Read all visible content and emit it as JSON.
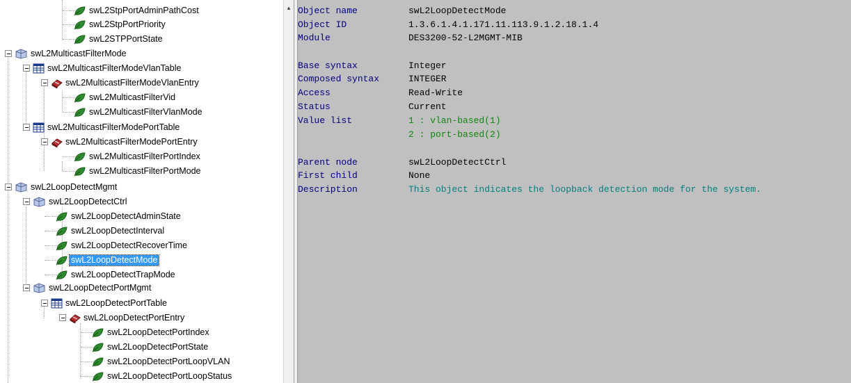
{
  "tree": {
    "items": [
      {
        "label": "swL2StpPortAdminPathCost",
        "icon": "leaf-icon"
      },
      {
        "label": "swL2StpPortPriority",
        "icon": "leaf-icon"
      },
      {
        "label": "swL2STPPortState",
        "icon": "leaf-icon"
      },
      {
        "label": "swL2MulticastFilterMode",
        "icon": "folder-icon"
      },
      {
        "label": "swL2MulticastFilterModeVlanTable",
        "icon": "table-icon"
      },
      {
        "label": "swL2MulticastFilterModeVlanEntry",
        "icon": "entry-icon"
      },
      {
        "label": "swL2MulticastFilterVid",
        "icon": "leaf-icon"
      },
      {
        "label": "swL2MulticastFilterVlanMode",
        "icon": "leaf-icon"
      },
      {
        "label": "swL2MulticastFilterModePortTable",
        "icon": "table-icon"
      },
      {
        "label": "swL2MulticastFilterModePortEntry",
        "icon": "entry-icon"
      },
      {
        "label": "swL2MulticastFilterPortIndex",
        "icon": "leaf-icon"
      },
      {
        "label": "swL2MulticastFilterPortMode",
        "icon": "leaf-icon"
      },
      {
        "label": "swL2LoopDetectMgmt",
        "icon": "folder-icon"
      },
      {
        "label": "swL2LoopDetectCtrl",
        "icon": "folder-icon"
      },
      {
        "label": "swL2LoopDetectAdminState",
        "icon": "leaf-icon"
      },
      {
        "label": "swL2LoopDetectInterval",
        "icon": "leaf-icon"
      },
      {
        "label": "swL2LoopDetectRecoverTime",
        "icon": "leaf-icon"
      },
      {
        "label": "swL2LoopDetectMode",
        "icon": "leaf-icon",
        "selected": true
      },
      {
        "label": "swL2LoopDetectTrapMode",
        "icon": "leaf-icon"
      },
      {
        "label": "swL2LoopDetectPortMgmt",
        "icon": "folder-icon"
      },
      {
        "label": "swL2LoopDetectPortTable",
        "icon": "table-icon"
      },
      {
        "label": "swL2LoopDetectPortEntry",
        "icon": "entry-icon"
      },
      {
        "label": "swL2LoopDetectPortIndex",
        "icon": "leaf-icon"
      },
      {
        "label": "swL2LoopDetectPortState",
        "icon": "leaf-icon"
      },
      {
        "label": "swL2LoopDetectPortLoopVLAN",
        "icon": "leaf-icon"
      },
      {
        "label": "swL2LoopDetectPortLoopStatus",
        "icon": "leaf-icon"
      }
    ]
  },
  "detail": {
    "object_name": {
      "key": "Object name",
      "value": "swL2LoopDetectMode"
    },
    "object_id": {
      "key": "Object ID",
      "value": "1.3.6.1.4.1.171.11.113.9.1.2.18.1.4"
    },
    "module": {
      "key": "Module",
      "value": "DES3200-52-L2MGMT-MIB"
    },
    "base_syntax": {
      "key": "Base syntax",
      "value": "Integer"
    },
    "composed_syntax": {
      "key": "Composed syntax",
      "value": "INTEGER"
    },
    "access": {
      "key": "Access",
      "value": "Read-Write"
    },
    "status": {
      "key": "Status",
      "value": "Current"
    },
    "value_list": {
      "key": "Value list",
      "values": [
        "1 : vlan-based(1)",
        "2 : port-based(2)"
      ]
    },
    "parent_node": {
      "key": "Parent node",
      "value": "swL2LoopDetectCtrl"
    },
    "first_child": {
      "key": "First child",
      "value": "None"
    },
    "description": {
      "key": "Description",
      "value": "This object indicates the loopback detection mode for the system."
    }
  },
  "colors": {
    "key": "#000080",
    "value_list": "#0a8a0a",
    "description": "#008080",
    "detail_background": "#c0c0c0",
    "selection": "#3399ff"
  }
}
